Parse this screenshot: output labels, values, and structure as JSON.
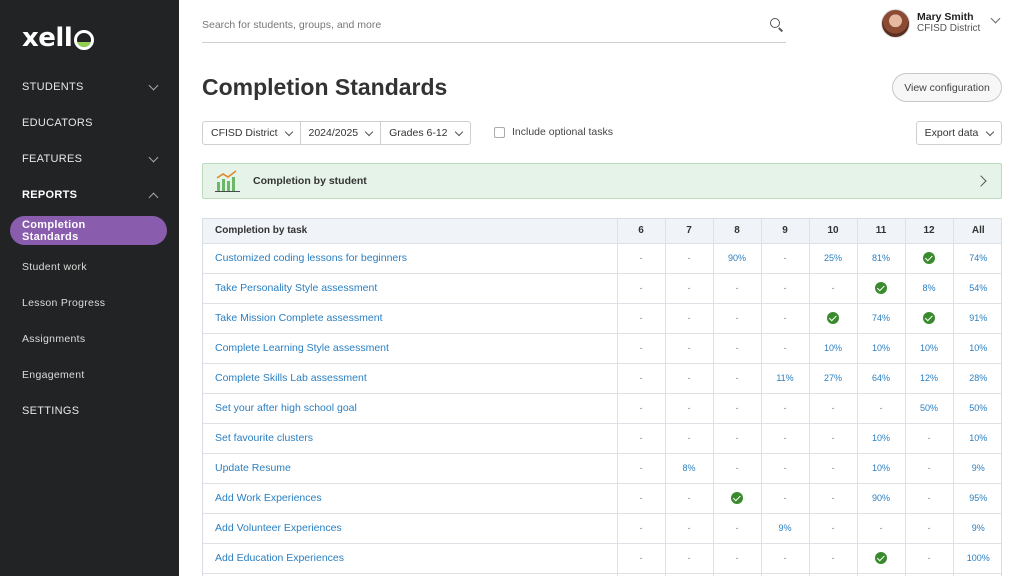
{
  "app": {
    "logo": "xell"
  },
  "sidebar": {
    "items": [
      {
        "label": "STUDENTS",
        "type": "top",
        "chevron": "down"
      },
      {
        "label": "EDUCATORS",
        "type": "top",
        "chevron": ""
      },
      {
        "label": "FEATURES",
        "type": "top",
        "chevron": "down"
      },
      {
        "label": "REPORTS",
        "type": "top-bold",
        "chevron": "up"
      },
      {
        "label": "Completion Standards",
        "type": "active",
        "chevron": ""
      },
      {
        "label": "Student work",
        "type": "sub",
        "chevron": ""
      },
      {
        "label": "Lesson Progress",
        "type": "sub",
        "chevron": ""
      },
      {
        "label": "Assignments",
        "type": "sub",
        "chevron": ""
      },
      {
        "label": "Engagement",
        "type": "sub",
        "chevron": ""
      },
      {
        "label": "SETTINGS",
        "type": "top",
        "chevron": ""
      }
    ]
  },
  "search": {
    "placeholder": "Search for students, groups, and more"
  },
  "user": {
    "name": "Mary Smith",
    "org": "CFISD District"
  },
  "page": {
    "title": "Completion Standards",
    "view_config": "View configuration"
  },
  "filters": {
    "district": "CFISD District",
    "year": "2024/2025",
    "grades": "Grades 6-12",
    "optional_label": "Include optional tasks",
    "export": "Export data"
  },
  "banner": {
    "label": "Completion by student"
  },
  "table": {
    "columns": [
      "Completion by task",
      "6",
      "7",
      "8",
      "9",
      "10",
      "11",
      "12",
      "All"
    ],
    "rows": [
      {
        "task": "Customized coding lessons for beginners",
        "cells": [
          "-",
          "-",
          "90%",
          "-",
          "25%",
          "81%",
          "check",
          "74%"
        ]
      },
      {
        "task": "Take Personality Style assessment",
        "cells": [
          "-",
          "-",
          "-",
          "-",
          "-",
          "check",
          "8%",
          "54%"
        ]
      },
      {
        "task": "Take Mission Complete assessment",
        "cells": [
          "-",
          "-",
          "-",
          "-",
          "check",
          "74%",
          "check",
          "91%"
        ]
      },
      {
        "task": "Complete Learning Style assessment",
        "cells": [
          "-",
          "-",
          "-",
          "-",
          "10%",
          "10%",
          "10%",
          "10%"
        ]
      },
      {
        "task": "Complete Skills Lab assessment",
        "cells": [
          "-",
          "-",
          "-",
          "11%",
          "27%",
          "64%",
          "12%",
          "28%"
        ]
      },
      {
        "task": "Set your after high school goal",
        "cells": [
          "-",
          "-",
          "-",
          "-",
          "-",
          "-",
          "50%",
          "50%"
        ]
      },
      {
        "task": "Set favourite clusters",
        "cells": [
          "-",
          "-",
          "-",
          "-",
          "-",
          "10%",
          "-",
          "10%"
        ]
      },
      {
        "task": "Update Resume",
        "cells": [
          "-",
          "8%",
          "-",
          "-",
          "-",
          "10%",
          "-",
          "9%"
        ]
      },
      {
        "task": "Add Work Experiences",
        "cells": [
          "-",
          "-",
          "check",
          "-",
          "-",
          "90%",
          "-",
          "95%"
        ]
      },
      {
        "task": "Add Volunteer Experiences",
        "cells": [
          "-",
          "-",
          "-",
          "9%",
          "-",
          "-",
          "-",
          "9%"
        ]
      },
      {
        "task": "Add Education Experiences",
        "cells": [
          "-",
          "-",
          "-",
          "-",
          "-",
          "check",
          "-",
          "100%"
        ]
      },
      {
        "task": "",
        "cells": [
          "",
          "",
          "",
          "",
          "",
          "",
          "",
          ""
        ]
      }
    ]
  },
  "colors": {
    "sidebar_bg": "#222324",
    "active_pill": "#8a5cad",
    "link": "#2a7fc1",
    "check": "#3a8a2e",
    "banner_bg": "#e6f3e8"
  }
}
